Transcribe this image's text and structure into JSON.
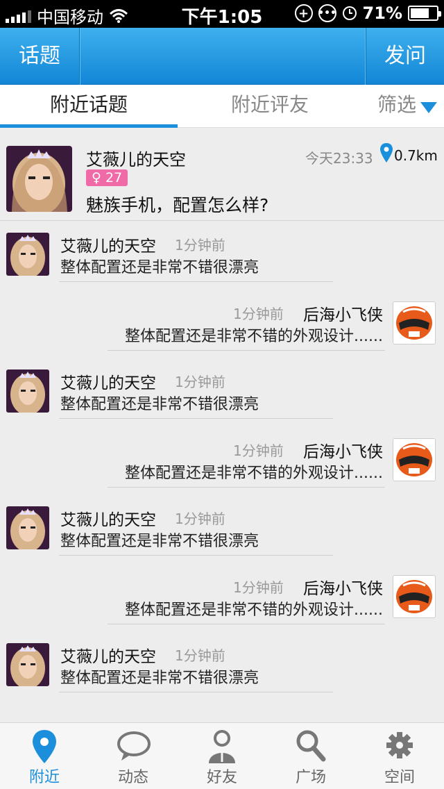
{
  "status_bar": {
    "carrier": "中国移动",
    "time": "下午1:05",
    "battery": "71%",
    "battery_level": 0.71,
    "icons": [
      "signal-icon",
      "wifi-icon",
      "plus-icon",
      "chat-icon",
      "clock-icon",
      "battery-icon"
    ]
  },
  "navbar": {
    "left_button": "话题",
    "right_button": "发问"
  },
  "tabs": {
    "items": [
      "附近话题",
      "附近评友",
      "筛选"
    ],
    "active_index": 0
  },
  "topic": {
    "author": "艾薇儿的天空",
    "gender_symbol": "♀",
    "age": "27",
    "time": "今天23:33",
    "distance": "0.7km",
    "title": "魅族手机，配置怎么样?"
  },
  "messages": [
    {
      "side": "left",
      "name": "艾薇儿的天空",
      "time": "1分钟前",
      "text": "整体配置还是非常不错很漂亮"
    },
    {
      "side": "right",
      "name": "后海小飞侠",
      "time": "1分钟前",
      "text": "整体配置还是非常不错的外观设计......"
    },
    {
      "side": "left",
      "name": "艾薇儿的天空",
      "time": "1分钟前",
      "text": "整体配置还是非常不错很漂亮"
    },
    {
      "side": "right",
      "name": "后海小飞侠",
      "time": "1分钟前",
      "text": "整体配置还是非常不错的外观设计......"
    },
    {
      "side": "left",
      "name": "艾薇儿的天空",
      "time": "1分钟前",
      "text": "整体配置还是非常不错很漂亮"
    },
    {
      "side": "right",
      "name": "后海小飞侠",
      "time": "1分钟前",
      "text": "整体配置还是非常不错的外观设计......"
    },
    {
      "side": "left",
      "name": "艾薇儿的天空",
      "time": "1分钟前",
      "text": "整体配置还是非常不错很漂亮"
    }
  ],
  "tabbar": {
    "items": [
      {
        "label": "附近",
        "icon": "location-pin-icon",
        "active": true
      },
      {
        "label": "动态",
        "icon": "speech-bubble-icon",
        "active": false
      },
      {
        "label": "好友",
        "icon": "person-icon",
        "active": false
      },
      {
        "label": "广场",
        "icon": "search-icon",
        "active": false
      },
      {
        "label": "空间",
        "icon": "gear-icon",
        "active": false
      }
    ]
  },
  "colors": {
    "accent": "#1b8fdb",
    "nav_top": "#3eb0ee",
    "nav_bottom": "#1286d6",
    "badge": "#f06aa8",
    "background": "#ededed"
  }
}
